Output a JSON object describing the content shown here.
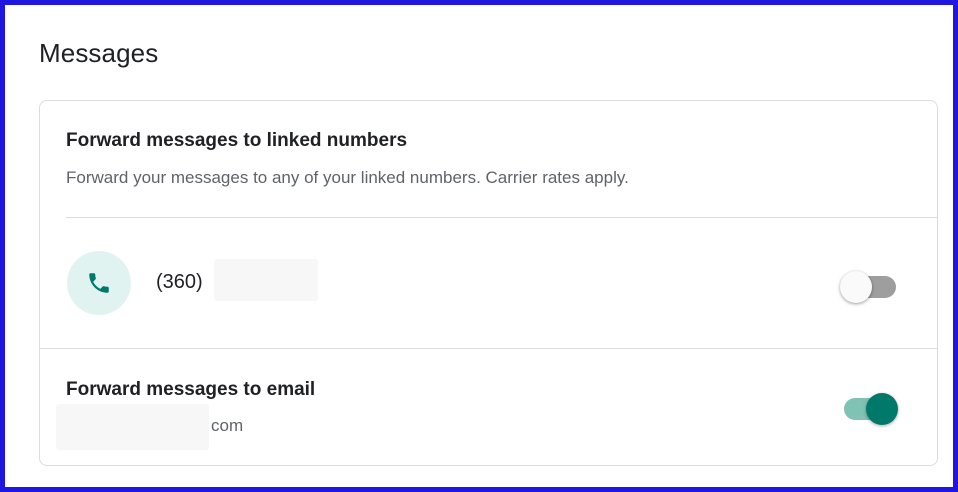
{
  "page": {
    "title": "Messages"
  },
  "linked_numbers": {
    "title": "Forward messages to linked numbers",
    "description": "Forward your messages to any of your linked numbers. Carrier rates apply.",
    "numbers": [
      {
        "number_visible": "(360)",
        "redacted": true,
        "forwarding_enabled": false,
        "icon": "phone-icon"
      }
    ]
  },
  "email_forwarding": {
    "title": "Forward messages to email",
    "email_visible_suffix": "com",
    "redacted": true,
    "enabled": true
  },
  "colors": {
    "border": "#1f16e0",
    "accent": "#00796b",
    "accent_track": "#80c2b4",
    "avatar_bg": "#e1f3f1",
    "toggle_off_track": "#9e9e9e"
  }
}
